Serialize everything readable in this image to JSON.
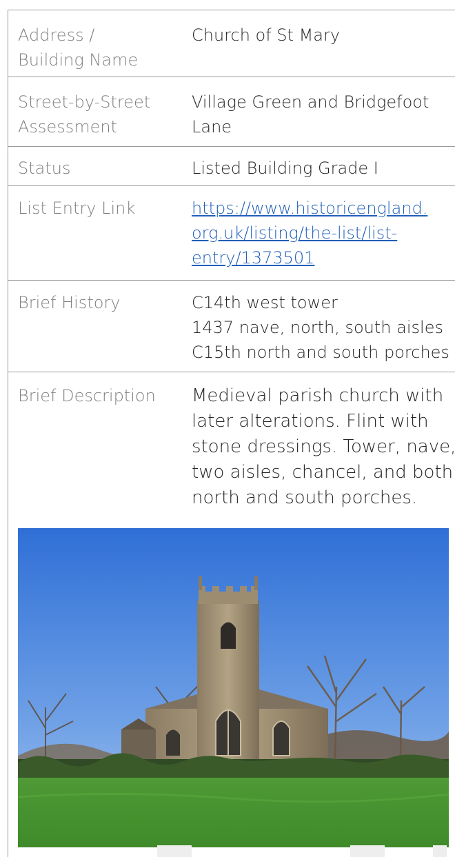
{
  "rows": [
    {
      "label": "Address / Building Name",
      "label_lines": [
        "Address /",
        "Building Name"
      ],
      "value_lines": [
        "Church of St Mary"
      ]
    },
    {
      "label": "Street-by-Street Assessment",
      "label_lines": [
        "Street-by-Street",
        "Assessment"
      ],
      "value_lines": [
        "Village Green and Bridgefoot",
        "Lane"
      ]
    },
    {
      "label": "Status",
      "label_lines": [
        "Status"
      ],
      "value_lines": [
        "Listed Building Grade I"
      ]
    },
    {
      "label": "List Entry Link",
      "label_lines": [
        "List Entry Link"
      ],
      "link_lines": [
        "https://www.historicengland.",
        "org.uk/listing/the-list/list-",
        "entry/1373501"
      ]
    },
    {
      "label": "Brief History",
      "label_lines": [
        "Brief History"
      ],
      "value_lines": [
        "C14th west tower",
        "1437 nave, north, south aisles",
        "C15th north and south porches"
      ]
    },
    {
      "label": "Brief Description",
      "label_lines": [
        "Brief Description"
      ],
      "value_lines": [
        "Medieval parish church with",
        "later alterations. Flint with",
        "stone dressings. Tower, nave,",
        "two aisles, chancel, and both",
        "north and south porches."
      ]
    }
  ],
  "link_color": "#1f5fb8",
  "label_color": "#808080",
  "text_color": "#262626"
}
